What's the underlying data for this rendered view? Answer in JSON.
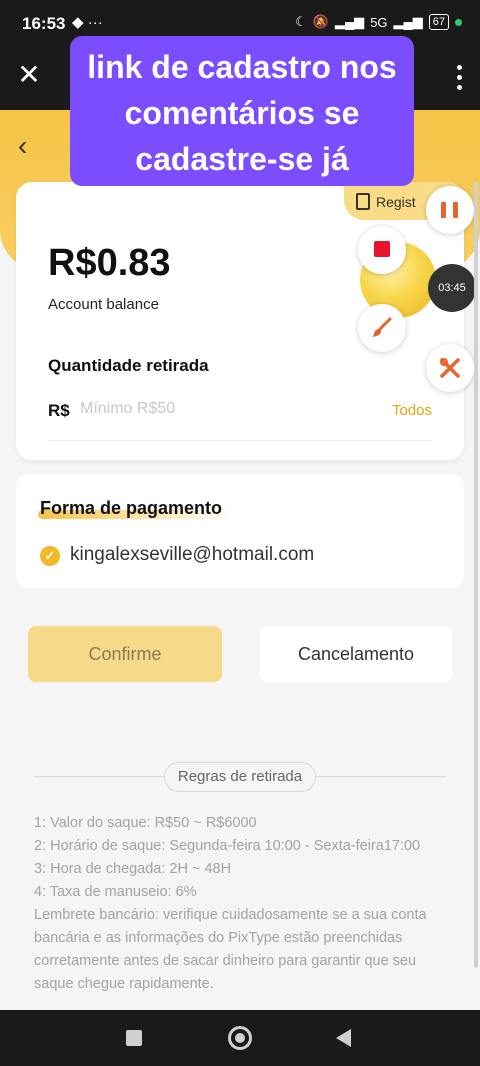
{
  "status_bar": {
    "time": "16:53",
    "left_icons": "◆ ···",
    "network": "5G",
    "battery": "67"
  },
  "overlay": {
    "lines": [
      "link de cadastro nos",
      "comentários se",
      "cadastre-se já"
    ]
  },
  "balance_card": {
    "regist_label": "Regist",
    "balance_value": "R$0.83",
    "balance_label": "Account balance",
    "withdraw_label": "Quantidade retirada",
    "currency_prefix": "R$",
    "amount_placeholder": "Mínimo R$50",
    "all_link": "Todos"
  },
  "recorder": {
    "timer": "03:45"
  },
  "payment": {
    "title": "Forma de pagamento",
    "email": "kingalexseville@hotmail.com"
  },
  "actions": {
    "confirm_label": "Confirme",
    "cancel_label": "Cancelamento"
  },
  "rules": {
    "title": "Regras de retirada",
    "lines": [
      "1: Valor do saque: R$50 ~ R$6000",
      "2: Horário de saque: Segunda-feira 10:00 - Sexta-feira17:00",
      "3: Hora de chegada: 2H ~ 48H",
      "4: Taxa de manuseio: 6%",
      "Lembrete bancário: verifique cuidadosamente se a sua conta bancária e as informações do PixType estão preenchidas corretamente antes de sacar dinheiro para garantir que seu saque chegue rapidamente."
    ]
  },
  "colors": {
    "accent": "#f6c447",
    "overlay": "#7c4dff",
    "link": "#e4a614"
  }
}
